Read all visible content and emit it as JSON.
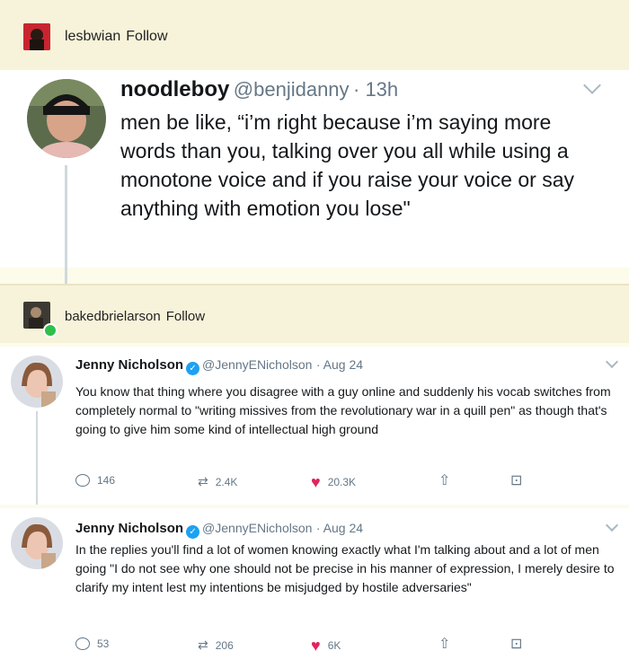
{
  "post1": {
    "username": "lesbwian",
    "follow_label": "Follow",
    "tweet": {
      "name": "noodleboy",
      "handle": "@benjidanny",
      "time": "· 13h",
      "text": "men be like, “i’m right because i’m saying more words than you, talking over you all while using a monotone voice and if you raise your voice or say anything with emotion you lose\""
    }
  },
  "post2": {
    "username": "bakedbrielarson",
    "follow_label": "Follow",
    "tweets": [
      {
        "name": "Jenny Nicholson",
        "handle": "@JennyENicholson",
        "time": "· Aug 24",
        "text": "You know that thing where you disagree with a guy online and suddenly his vocab switches from completely normal to \"writing missives from the revolutionary war in a quill pen\" as though that's going to give him some kind of intellectual high ground",
        "replies": "146",
        "retweets": "2.4K",
        "likes": "20.3K"
      },
      {
        "name": "Jenny Nicholson",
        "handle": "@JennyENicholson",
        "time": "· Aug 24",
        "text": "In the replies you'll find a lot of women knowing exactly what I'm talking about and a lot of men going \"I do not see why one should not be precise in his manner of expression, I merely desire to clarify my intent lest my intentions be misjudged by hostile adversaries\"",
        "replies": "53",
        "retweets": "206",
        "likes": "6K"
      }
    ]
  },
  "colors": {
    "background": "#fdfbea",
    "tweet_bg": "#ffffff",
    "like": "#e0245e",
    "verified": "#1da1f2",
    "muted": "#657786"
  }
}
